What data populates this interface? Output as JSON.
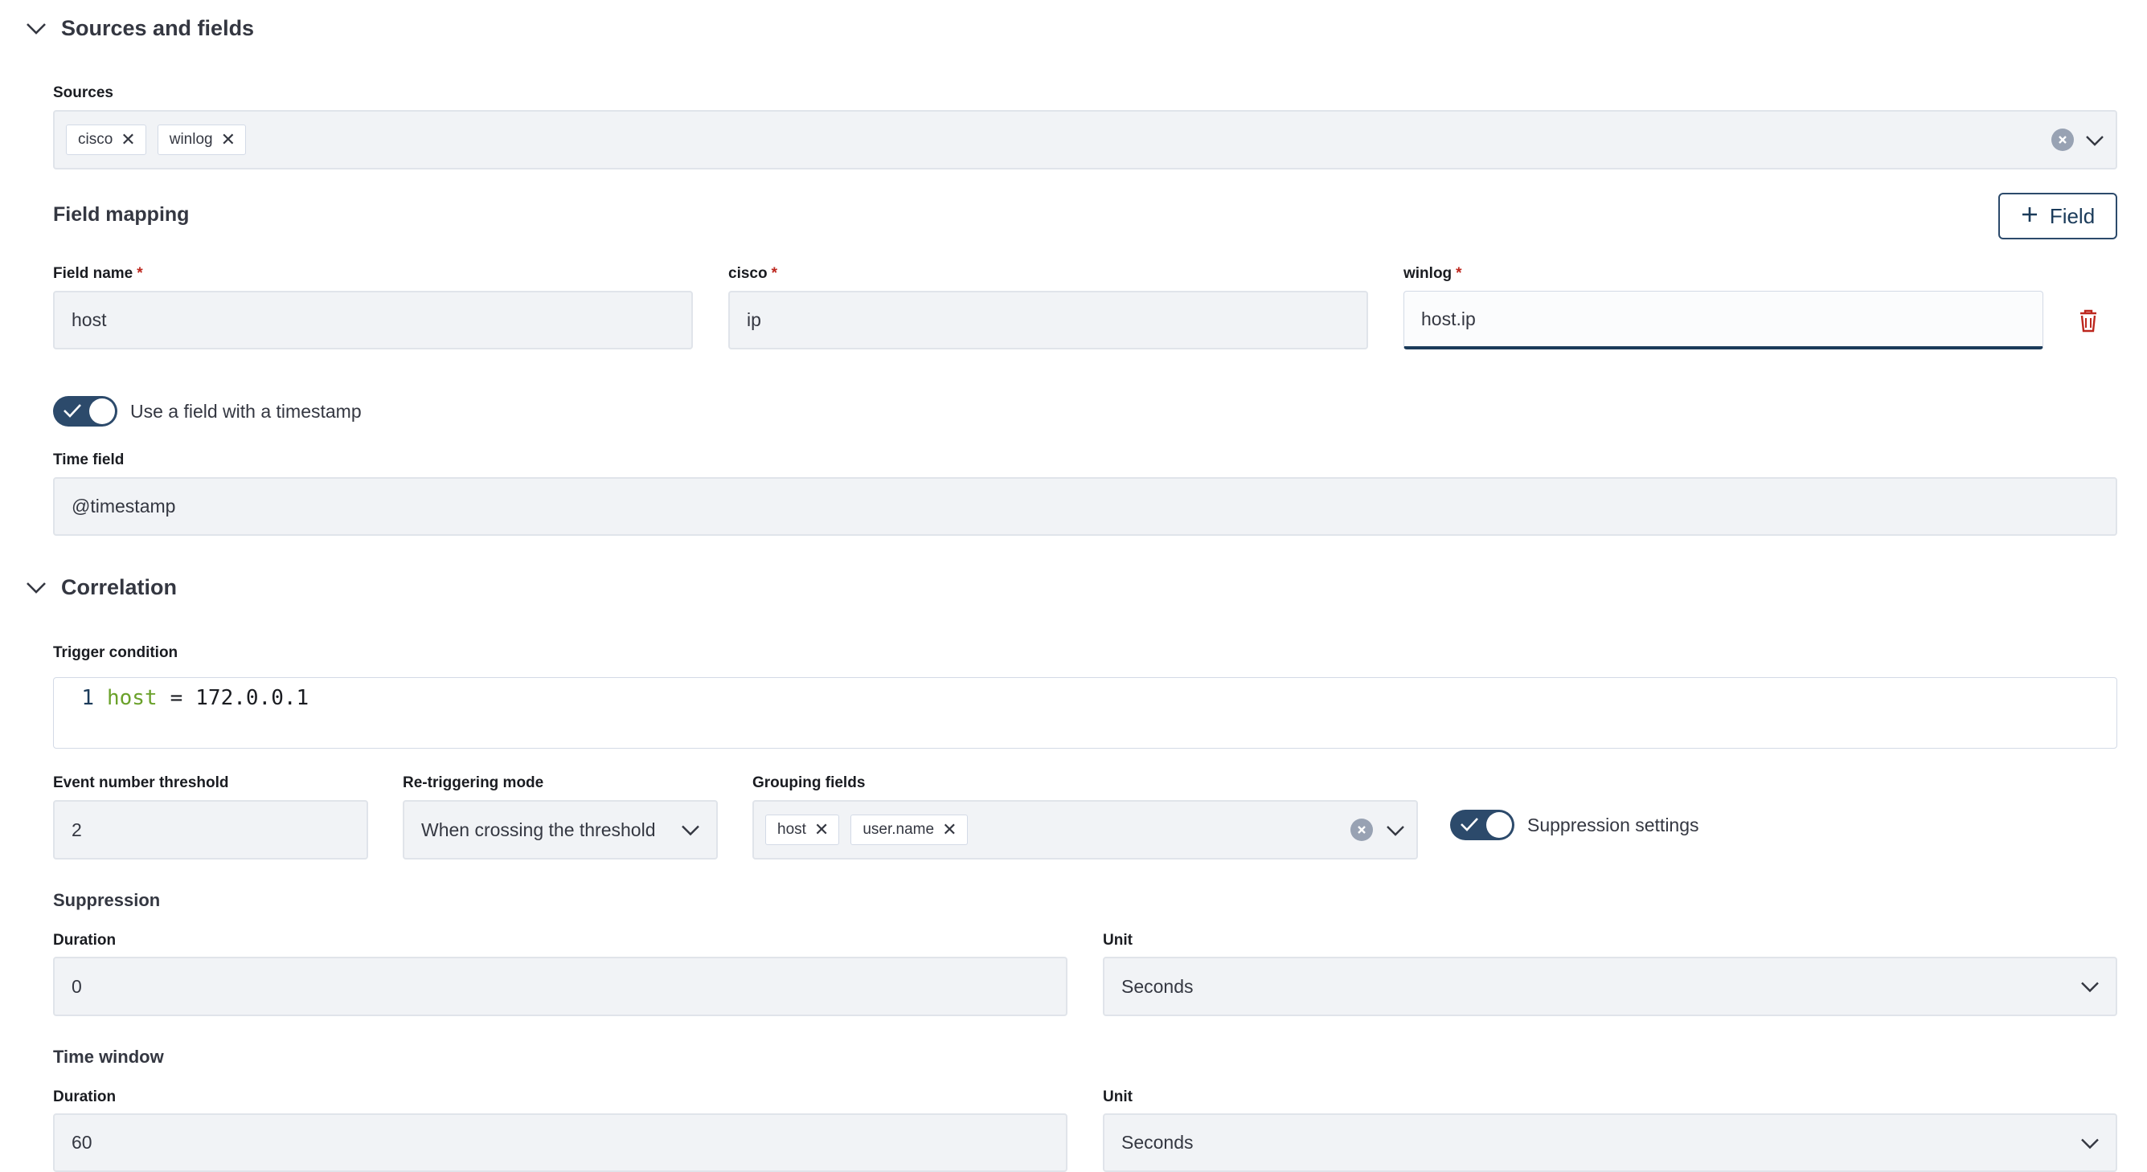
{
  "sources_section": {
    "title": "Sources and fields",
    "sources_label": "Sources",
    "sources": [
      "cisco",
      "winlog"
    ]
  },
  "field_mapping": {
    "title": "Field mapping",
    "add_field_label": "Field",
    "columns": {
      "field_name_label": "Field name",
      "cisco_label": "cisco",
      "winlog_label": "winlog",
      "required_marker": "*"
    },
    "row": {
      "field_name": "host",
      "cisco": "ip",
      "winlog": "host.ip"
    },
    "timestamp_toggle_label": "Use a field with a timestamp",
    "timestamp_toggle_on": true,
    "time_field_label": "Time field",
    "time_field_value": "@timestamp"
  },
  "correlation": {
    "title": "Correlation",
    "trigger_condition_label": "Trigger condition",
    "trigger_code": {
      "line_number": "1",
      "field": "host",
      "operator": "=",
      "value": "172.0.0.1"
    },
    "event_threshold_label": "Event number threshold",
    "event_threshold_value": "2",
    "retrigger_label": "Re-triggering mode",
    "retrigger_value": "When crossing the threshold",
    "grouping_label": "Grouping fields",
    "grouping_fields": [
      "host",
      "user.name"
    ],
    "suppression_toggle_label": "Suppression settings",
    "suppression_toggle_on": true,
    "suppression": {
      "title": "Suppression",
      "duration_label": "Duration",
      "duration_value": "0",
      "unit_label": "Unit",
      "unit_value": "Seconds"
    },
    "time_window": {
      "title": "Time window",
      "duration_label": "Duration",
      "duration_value": "60",
      "unit_label": "Unit",
      "unit_value": "Seconds"
    }
  },
  "colors": {
    "accent": "#1b3b5a",
    "toggle_on": "#2c4a6b",
    "danger": "#bd271e",
    "code_keyword": "#6aa12a"
  }
}
